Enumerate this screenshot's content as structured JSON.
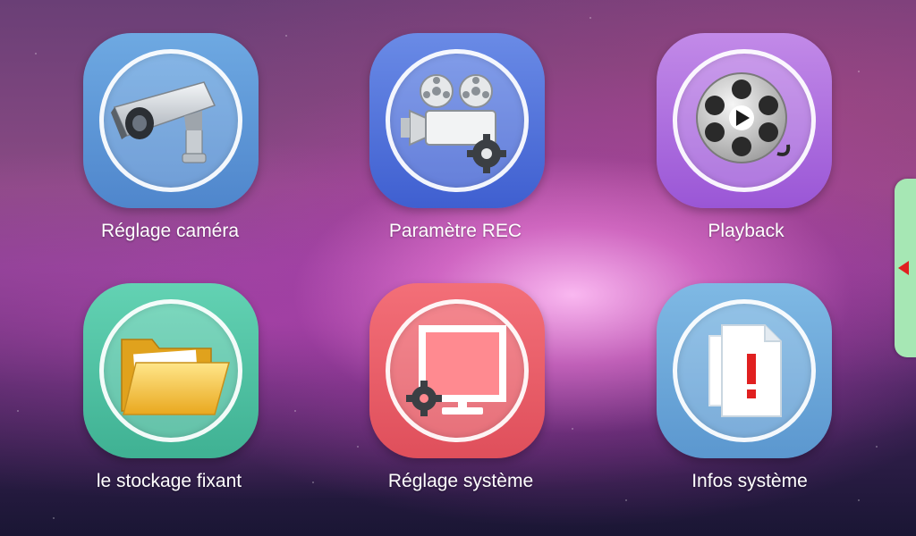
{
  "menu": {
    "items": [
      {
        "label": "Réglage caméra",
        "icon": "security-camera-icon"
      },
      {
        "label": "Paramètre REC",
        "icon": "movie-camera-gear-icon"
      },
      {
        "label": "Playback",
        "icon": "film-reel-play-icon"
      },
      {
        "label": "le stockage fixant",
        "icon": "folder-icon"
      },
      {
        "label": "Réglage système",
        "icon": "monitor-gear-icon"
      },
      {
        "label": "Infos système",
        "icon": "document-alert-icon"
      }
    ]
  },
  "side_tab": {
    "icon": "arrow-left-icon"
  },
  "colors": {
    "camera_tile": "#5f98d8",
    "rec_tile": "#5575dc",
    "playback_tile": "#ae70df",
    "storage_tile": "#51c2a3",
    "system_tile": "#e95f69",
    "info_tile": "#6da8da",
    "side_tab": "#a6e7b4",
    "arrow": "#e02020"
  }
}
